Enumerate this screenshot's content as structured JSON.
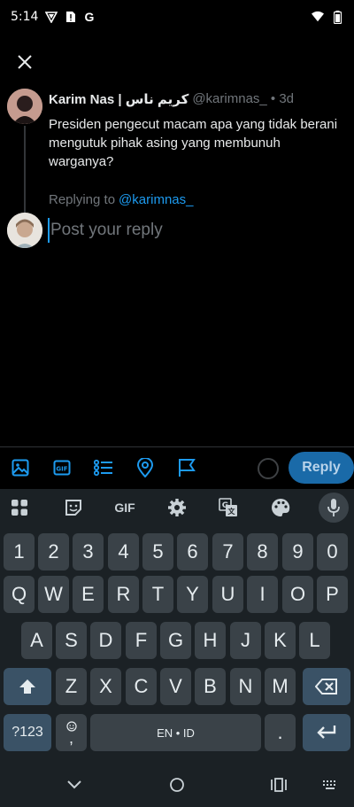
{
  "status_bar": {
    "time": "5:14",
    "g_label": "G"
  },
  "tweet": {
    "author_name": "Karim Nas | كريم ناس",
    "handle_time": "@karimnas_ • 3d",
    "text": "Presiden pengecut macam apa yang tidak berani mengutuk pihak asing yang membunuh warganya?"
  },
  "reply": {
    "replying_to_label": "Replying to",
    "replying_to_handle": "@karimnas_",
    "placeholder": "Post your reply",
    "reply_button_label": "Reply"
  },
  "keyboard": {
    "gif_label": "GIF",
    "number_row": [
      "1",
      "2",
      "3",
      "4",
      "5",
      "6",
      "7",
      "8",
      "9",
      "0"
    ],
    "row1": [
      "Q",
      "W",
      "E",
      "R",
      "T",
      "Y",
      "U",
      "I",
      "O",
      "P"
    ],
    "row2": [
      "A",
      "S",
      "D",
      "F",
      "G",
      "H",
      "J",
      "K",
      "L"
    ],
    "row3": [
      "Z",
      "X",
      "C",
      "V",
      "B",
      "N",
      "M"
    ],
    "mode_label": "?123",
    "comma_label": ",",
    "space_label": "EN • ID",
    "period_label": "."
  },
  "colors": {
    "accent": "#1d9bf0",
    "reply_button": "#1a6aa8",
    "keyboard_bg": "#1b2125",
    "key_bg": "#3a4248"
  },
  "icons": {
    "compose_toolbar": [
      "image-icon",
      "gif-icon",
      "poll-icon",
      "location-icon",
      "flag-icon"
    ],
    "keyboard_toolbar": [
      "apps-grid-icon",
      "sticker-icon",
      "gif-icon",
      "settings-icon",
      "translate-icon",
      "palette-icon",
      "mic-icon"
    ]
  }
}
